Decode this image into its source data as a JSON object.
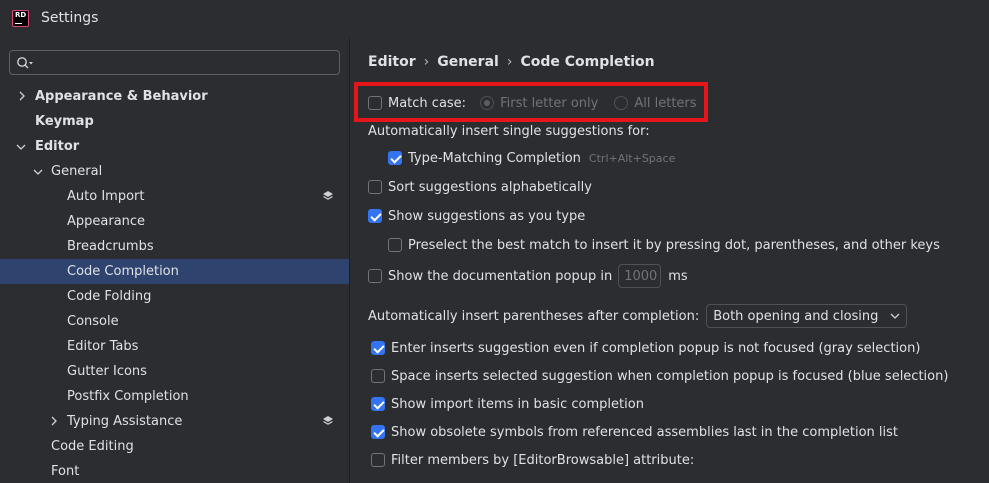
{
  "window": {
    "title": "Settings",
    "logo_text": "RD"
  },
  "search": {
    "value": "",
    "placeholder": ""
  },
  "tree": {
    "items": [
      {
        "label": "Appearance & Behavior"
      },
      {
        "label": "Keymap"
      },
      {
        "label": "Editor"
      },
      {
        "label": "General"
      },
      {
        "label": "Auto Import"
      },
      {
        "label": "Appearance"
      },
      {
        "label": "Breadcrumbs"
      },
      {
        "label": "Code Completion"
      },
      {
        "label": "Code Folding"
      },
      {
        "label": "Console"
      },
      {
        "label": "Editor Tabs"
      },
      {
        "label": "Gutter Icons"
      },
      {
        "label": "Postfix Completion"
      },
      {
        "label": "Typing Assistance"
      },
      {
        "label": "Code Editing"
      },
      {
        "label": "Font"
      }
    ]
  },
  "breadcrumb": {
    "items": [
      "Editor",
      "General",
      "Code Completion"
    ],
    "separator": "›"
  },
  "options": {
    "match_case": {
      "label": "Match case:",
      "checked": false
    },
    "first_letter_only": {
      "label": "First letter only"
    },
    "all_letters": {
      "label": "All letters"
    },
    "auto_insert_heading": "Automatically insert single suggestions for:",
    "type_matching": {
      "label": "Type-Matching Completion",
      "shortcut": "Ctrl+Alt+Space"
    },
    "sort_alpha": {
      "label": "Sort suggestions alphabetically"
    },
    "show_as_you_type": {
      "label": "Show suggestions as you type"
    },
    "preselect": {
      "label": "Preselect the best match to insert it by pressing dot, parentheses, and other keys"
    },
    "doc_popup": {
      "label": "Show the documentation popup in",
      "value": "1000",
      "unit": "ms"
    },
    "parentheses": {
      "label": "Automatically insert parentheses after completion:",
      "selected": "Both opening and closing"
    },
    "enter_inserts": {
      "label": "Enter inserts suggestion even if completion popup is not focused (gray selection)"
    },
    "space_inserts": {
      "label": "Space inserts selected suggestion when completion popup is focused (blue selection)"
    },
    "import_items": {
      "label": "Show import items in basic completion"
    },
    "obsolete": {
      "label": "Show obsolete symbols from referenced assemblies last in the completion list"
    },
    "filter_members": {
      "label": "Filter members by [EditorBrowsable] attribute:"
    }
  },
  "colors": {
    "accent": "#3574f0",
    "selection": "#2e436e",
    "highlight": "#e5161a",
    "background": "#2b2d30"
  }
}
